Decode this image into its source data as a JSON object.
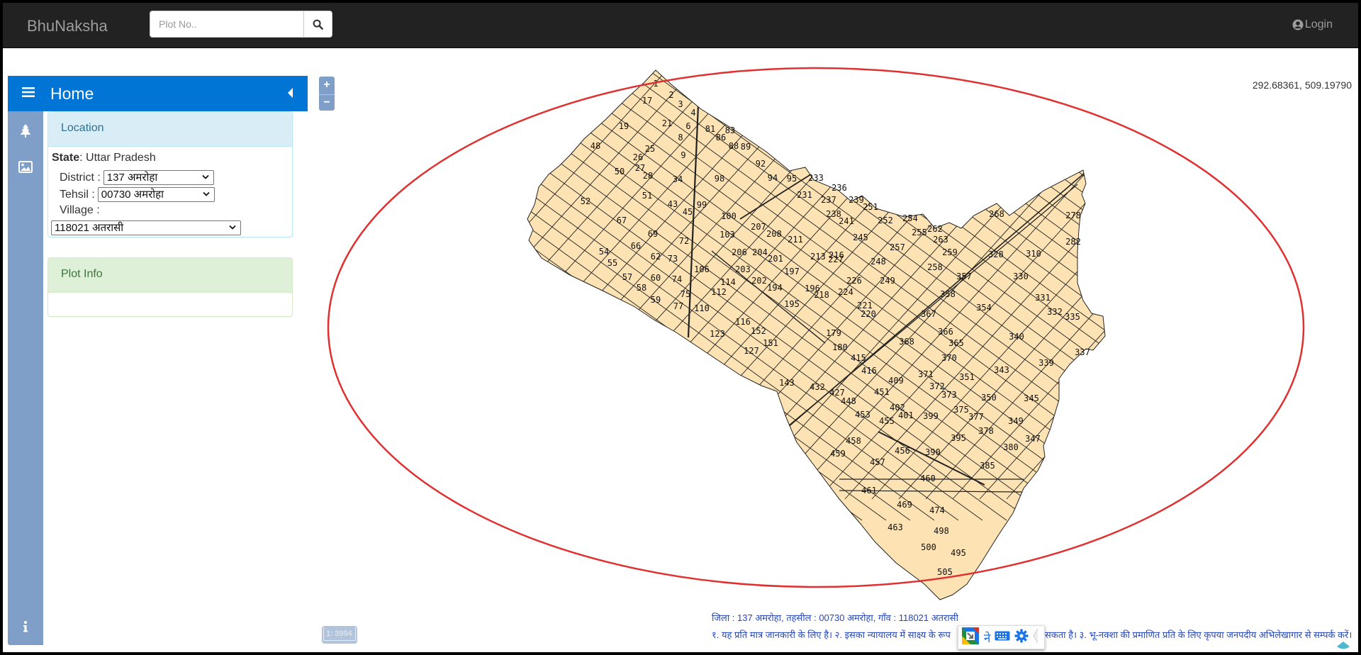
{
  "navbar": {
    "brand": "BhuNaksha",
    "search_placeholder": "Plot No..",
    "search_icon": "search-icon",
    "login_label": "Login",
    "login_icon": "user-circle-icon"
  },
  "panel": {
    "title": "Home",
    "menu_icon": "hamburger-icon",
    "collapse_icon": "caret-left-icon",
    "strip_icons": [
      "tree-icon",
      "image-icon",
      "info-icon"
    ],
    "location": {
      "heading": "Location",
      "state_label": "State",
      "state_value": "Uttar Pradesh",
      "district_label": "District :",
      "district_value": "137 अमरोहा",
      "tehsil_label": "Tehsil :",
      "tehsil_value": "00730 अमरोहा",
      "village_label": "Village :",
      "village_value": "118021 अतरासी"
    },
    "plot_info": {
      "heading": "Plot Info"
    }
  },
  "map": {
    "zoom_in": "+",
    "zoom_out": "−",
    "coordinates": "292.68361, 509.19790",
    "scale": "1: 3994",
    "annotation_color": "#e03030",
    "parcel_fill": "#fde3b4",
    "plots": [
      "1",
      "2",
      "3",
      "4",
      "6",
      "8",
      "9",
      "17",
      "19",
      "21",
      "25",
      "26",
      "27",
      "28",
      "34",
      "43",
      "45",
      "48",
      "50",
      "51",
      "52",
      "54",
      "55",
      "57",
      "58",
      "59",
      "60",
      "62",
      "66",
      "67",
      "69",
      "72",
      "73",
      "74",
      "75",
      "77",
      "81",
      "83",
      "86",
      "88",
      "89",
      "92",
      "94",
      "95",
      "98",
      "99",
      "100",
      "103",
      "106",
      "110",
      "112",
      "114",
      "116",
      "123",
      "127",
      "143",
      "151",
      "152",
      "179",
      "180",
      "194",
      "195",
      "196",
      "197",
      "201",
      "202",
      "203",
      "204",
      "206",
      "207",
      "208",
      "211",
      "213",
      "216",
      "218",
      "220",
      "221",
      "224",
      "226",
      "227",
      "231",
      "233",
      "236",
      "237",
      "238",
      "239",
      "241",
      "245",
      "248",
      "249",
      "251",
      "252",
      "254",
      "255",
      "257",
      "258",
      "259",
      "262",
      "263",
      "268",
      "278",
      "282",
      "310",
      "328",
      "330",
      "331",
      "332",
      "335",
      "337",
      "339",
      "340",
      "343",
      "345",
      "347",
      "349",
      "350",
      "351",
      "354",
      "357",
      "358",
      "365",
      "366",
      "367",
      "368",
      "370",
      "371",
      "372",
      "373",
      "375",
      "377",
      "378",
      "380",
      "385",
      "390",
      "395",
      "399",
      "401",
      "402",
      "409",
      "415",
      "416",
      "427",
      "432",
      "448",
      "451",
      "453",
      "455",
      "456",
      "457",
      "458",
      "459",
      "460",
      "461",
      "463",
      "469",
      "474",
      "495",
      "498",
      "500",
      "505"
    ]
  },
  "footer": {
    "line1": "जिला : 137 अमरोहा, तहसील : 00730 अमरोहा, गाँव : 118021 अतरासी",
    "line2a": "१. यह प्रति मात्र जानकारी के लिए है। २. इसका न्यायालय में साक्ष्य के रूप",
    "line2b": "सकता है। ३. भू-नक्शा की प्रमाणित प्रति के लिए कृपया जनपदीय अभिलेखागार से सम्पर्क करें।",
    "ime_char": "ने"
  }
}
